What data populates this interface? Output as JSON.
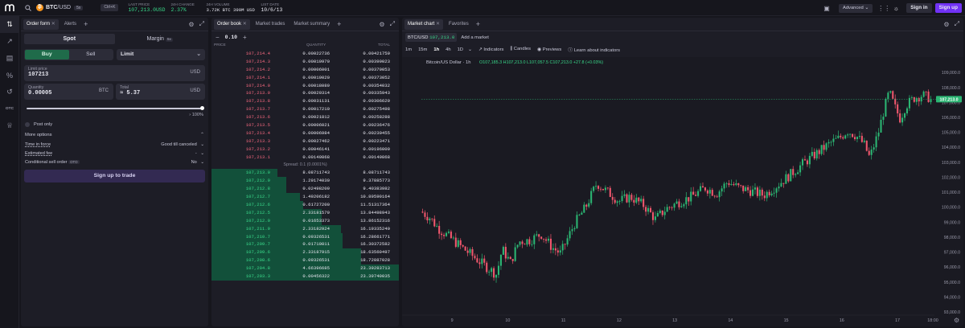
{
  "header": {
    "pair": "BTC/USD",
    "pair_base": "BTC",
    "pair_quote": "/USD",
    "leverage": "5x",
    "shortcut": "Ctrl+K",
    "stats": [
      {
        "label": "LAST PRICE",
        "value": "107,213.0USD",
        "color": "#39d98a"
      },
      {
        "label": "24H CHANGE",
        "value": "2.37%",
        "color": "#39d98a"
      },
      {
        "label": "24H VOLUME",
        "value": "3.72K BTC  399M USD",
        "color": "#e6e6ef"
      },
      {
        "label": "LIST DATE",
        "value": "10/6/13",
        "color": "#e6e6ef"
      }
    ],
    "mode": "Advanced",
    "signin": "Sign in",
    "signup": "Sign up"
  },
  "rail_icons": [
    "trade-icon",
    "chart-icon",
    "wallet-icon",
    "percent-icon",
    "history-icon",
    "otc-icon",
    "trophy-icon"
  ],
  "rail_otc": "OTC",
  "order_form": {
    "tabs": [
      "Order form",
      "Alerts"
    ],
    "spot": "Spot",
    "margin": "Margin",
    "margin_badge": "5x",
    "buy": "Buy",
    "sell": "Sell",
    "order_type": "Limit",
    "limit_price_label": "Limit price",
    "limit_price_value": "107213",
    "limit_price_unit": "USD",
    "quantity_label": "Quantity",
    "quantity_value": "0.00005",
    "quantity_unit": "BTC",
    "total_label": "Total",
    "total_value": "≈ 5.37",
    "total_unit": "USD",
    "slider_percent": "100%",
    "post_only": "Post only",
    "more_options": "More options",
    "time_in_force_label": "Time in force",
    "time_in_force_value": "Good till canceled",
    "estimated_fee_label": "Estimated fee",
    "estimated_fee_value": "-",
    "conditional_label": "Conditional sell order",
    "conditional_badge": "OTO",
    "conditional_value": "No",
    "submit": "Sign up to trade"
  },
  "order_book": {
    "tabs": [
      "Order book",
      "Market trades",
      "Market summary"
    ],
    "tick": "0.10",
    "col_price": "PRICE",
    "col_qty": "QUANTITY",
    "col_total": "TOTAL",
    "spread": "Spread: 0.1 (0.0001%)",
    "asks": [
      {
        "price": "107,214.4",
        "qty": "0.00022736",
        "total": "0.00421759"
      },
      {
        "price": "107,214.3",
        "qty": "0.00019970",
        "total": "0.00399023"
      },
      {
        "price": "107,214.2",
        "qty": "0.00006001",
        "total": "0.00379053"
      },
      {
        "price": "107,214.1",
        "qty": "0.00019020",
        "total": "0.00373052"
      },
      {
        "price": "107,214.0",
        "qty": "0.00018089",
        "total": "0.00354032"
      },
      {
        "price": "107,213.9",
        "qty": "0.00029314",
        "total": "0.00335943"
      },
      {
        "price": "107,213.8",
        "qty": "0.00031131",
        "total": "0.00306629"
      },
      {
        "price": "107,213.7",
        "qty": "0.00017210",
        "total": "0.00275498"
      },
      {
        "price": "107,213.6",
        "qty": "0.00021812",
        "total": "0.00258288"
      },
      {
        "price": "107,213.5",
        "qty": "0.00006021",
        "total": "0.00236476"
      },
      {
        "price": "107,213.4",
        "qty": "0.00006984",
        "total": "0.00230455"
      },
      {
        "price": "107,213.3",
        "qty": "0.00027462",
        "total": "0.00223471"
      },
      {
        "price": "107,213.2",
        "qty": "0.00046141",
        "total": "0.00196009"
      },
      {
        "price": "107,213.1",
        "qty": "0.00149868",
        "total": "0.00149868"
      }
    ],
    "bids": [
      {
        "price": "107,213.0",
        "qty": "8.08711743",
        "total": "8.08711743",
        "depth": 0.35
      },
      {
        "price": "107,212.9",
        "qty": "1.29174030",
        "total": "9.37885773",
        "depth": 0.4
      },
      {
        "price": "107,212.8",
        "qty": "0.02498209",
        "total": "9.40383982",
        "depth": 0.4
      },
      {
        "price": "107,212.7",
        "qty": "1.49206182",
        "total": "10.89590164",
        "depth": 0.47
      },
      {
        "price": "107,212.6",
        "qty": "0.61727200",
        "total": "11.51317364",
        "depth": 0.49
      },
      {
        "price": "107,212.5",
        "qty": "2.33181579",
        "total": "13.84498943",
        "depth": 0.59
      },
      {
        "price": "107,212.0",
        "qty": "0.01653373",
        "total": "13.86152316",
        "depth": 0.59
      },
      {
        "price": "107,211.9",
        "qty": "2.33182924",
        "total": "16.19335240",
        "depth": 0.69
      },
      {
        "price": "107,210.7",
        "qty": "0.09326531",
        "total": "16.28661771",
        "depth": 0.7
      },
      {
        "price": "107,209.7",
        "qty": "0.01710811",
        "total": "16.30372582",
        "depth": 0.7
      },
      {
        "price": "107,209.6",
        "qty": "2.33187915",
        "total": "18.63560497",
        "depth": 0.8
      },
      {
        "price": "107,208.6",
        "qty": "0.09326531",
        "total": "18.72887028",
        "depth": 0.8
      },
      {
        "price": "107,204.8",
        "qty": "4.66396685",
        "total": "23.39283713",
        "depth": 1.0
      },
      {
        "price": "107,203.3",
        "qty": "0.00456322",
        "total": "23.39740035",
        "depth": 1.0
      }
    ]
  },
  "chart_panel": {
    "tabs": [
      "Market chart",
      "Favorites"
    ],
    "pair_tab": "BTC/USD",
    "pair_tab_price": "107,213.0",
    "add_market": "Add a market",
    "timeframes": [
      "1m",
      "15m",
      "1h",
      "4h",
      "1D"
    ],
    "active_timeframe": "1h",
    "tools": [
      "Indicators",
      "Candles",
      "Previews",
      "Learn about indicators"
    ],
    "legend_title": "Bitcoin/US Dollar · 1h",
    "ohlc": "O107,185.3  H107,213.0  L107,057.5  C107,213.0  +27.8 (+0.03%)",
    "time_label": "18:00",
    "current_price_label": "107,213.0",
    "drawing_tools": [
      "crosshair-icon",
      "trendline-icon",
      "fib-icon",
      "pattern-icon",
      "projection-icon",
      "brush-icon",
      "text-icon",
      "emoji-icon",
      "ruler-icon",
      "zoom-icon",
      "magnet-icon",
      "pencil-lock-icon",
      "lock-icon",
      "eye-icon",
      "trash-icon"
    ]
  },
  "chart_data": {
    "type": "candlestick",
    "title": "Bitcoin/US Dollar · 1h",
    "xlabel": "",
    "ylabel": "",
    "x_ticks": [
      "9",
      "10",
      "11",
      "12",
      "13",
      "14",
      "15",
      "16",
      "17"
    ],
    "y_ticks": [
      "109,000.0",
      "108,000.0",
      "107,000.0",
      "106,000.0",
      "105,000.0",
      "104,000.0",
      "103,000.0",
      "102,000.0",
      "101,000.0",
      "100,000.0",
      "99,000.0",
      "98,000.0",
      "97,000.0",
      "96,000.0",
      "95,000.0",
      "94,000.0",
      "93,000.0"
    ],
    "ylim": [
      93000,
      109600
    ],
    "x_start_day": 8.45,
    "x_end_day": 17.62,
    "last_price": 107213.0,
    "colors": {
      "up": "#2bb673",
      "down": "#f0576d"
    },
    "close_path": [
      [
        8.45,
        99700
      ],
      [
        8.6,
        99300
      ],
      [
        8.75,
        98600
      ],
      [
        8.95,
        98000
      ],
      [
        9.15,
        97400
      ],
      [
        9.35,
        96800
      ],
      [
        9.55,
        96200
      ],
      [
        9.8,
        95500
      ],
      [
        9.9,
        97200
      ],
      [
        10.05,
        96300
      ],
      [
        10.2,
        97700
      ],
      [
        10.4,
        97800
      ],
      [
        10.6,
        98200
      ],
      [
        10.8,
        97300
      ],
      [
        10.95,
        96900
      ],
      [
        11.05,
        97700
      ],
      [
        11.2,
        98900
      ],
      [
        11.4,
        100000
      ],
      [
        11.6,
        101600
      ],
      [
        11.8,
        101000
      ],
      [
        12.0,
        100400
      ],
      [
        12.2,
        100700
      ],
      [
        12.45,
        100100
      ],
      [
        12.65,
        99200
      ],
      [
        12.85,
        99900
      ],
      [
        13.05,
        100300
      ],
      [
        13.3,
        100700
      ],
      [
        13.55,
        101300
      ],
      [
        13.75,
        100900
      ],
      [
        13.95,
        101700
      ],
      [
        14.15,
        101300
      ],
      [
        14.35,
        101100
      ],
      [
        14.6,
        100800
      ],
      [
        14.85,
        101500
      ],
      [
        15.05,
        102100
      ],
      [
        15.3,
        102900
      ],
      [
        15.55,
        103600
      ],
      [
        15.8,
        104300
      ],
      [
        15.95,
        104600
      ],
      [
        16.1,
        105100
      ],
      [
        16.25,
        104800
      ],
      [
        16.4,
        104200
      ],
      [
        16.5,
        103300
      ],
      [
        16.65,
        104900
      ],
      [
        16.75,
        106400
      ],
      [
        16.85,
        107700
      ],
      [
        16.95,
        106700
      ],
      [
        17.05,
        105900
      ],
      [
        17.15,
        106800
      ],
      [
        17.3,
        107300
      ],
      [
        17.45,
        107500
      ],
      [
        17.62,
        107213
      ]
    ]
  }
}
